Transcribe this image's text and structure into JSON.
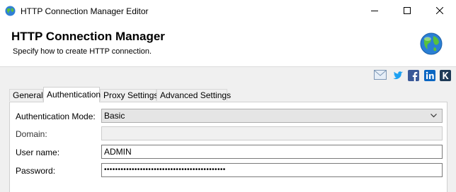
{
  "window": {
    "title": "HTTP Connection Manager Editor"
  },
  "header": {
    "title": "HTTP Connection Manager",
    "subtitle": "Specify how to create HTTP connection."
  },
  "social": [
    "mail-icon",
    "twitter-icon",
    "facebook-icon",
    "linkedin-icon",
    "k-icon"
  ],
  "tabs": [
    {
      "label": "General"
    },
    {
      "label": "Authentication",
      "selected": true
    },
    {
      "label": "Proxy Settings"
    },
    {
      "label": "Advanced Settings"
    }
  ],
  "form": {
    "auth_mode_label": "Authentication Mode:",
    "auth_mode_value": "Basic",
    "domain_label": "Domain:",
    "domain_value": "",
    "username_label": "User name:",
    "username_value": "ADMIN",
    "password_label": "Password:",
    "password_value": "••••••••••••••••••••••••••••••••••••••••••••"
  },
  "colors": {
    "content_bg": "#f0f0f0",
    "twitter": "#1da1f2",
    "facebook": "#3b5998",
    "linkedin": "#0a66c2"
  }
}
